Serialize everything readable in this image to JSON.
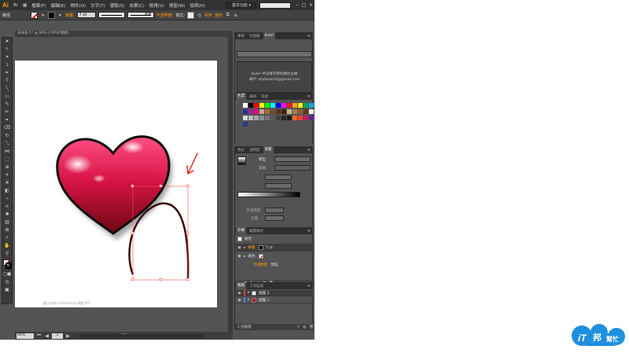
{
  "app": {
    "logo": "Ai"
  },
  "menu": [
    "檔案(F)",
    "編輯(E)",
    "物件(O)",
    "文字(T)",
    "選取(S)",
    "效果(C)",
    "檢視(V)",
    "視窗(W)",
    "說明(H)"
  ],
  "workspace": {
    "label": "基本功能 ▾"
  },
  "control_bar": {
    "selection_label": "路徑",
    "stroke_label": "筆畫:",
    "stroke_weight": "7 pt",
    "stroke_profile_label": "基本",
    "opacity_label": "不透明度:",
    "style_label": "樣式:",
    "align_label": "對齊",
    "transform_label": "變形"
  },
  "document": {
    "tab_label": "未命名-1* @ 90% (CMYK/預視)"
  },
  "canvas": {
    "watermark": "圖片來源 shutterstock 網路 PPT"
  },
  "status": {
    "zoom": "90%",
    "page": "1",
    "mode": "選取"
  },
  "panels": {
    "kuler": {
      "tabs": [
        "筆刷",
        "符號庫",
        "Kuler"
      ],
      "active_tab": "Kuler",
      "line1": "Kuler 中沒有可用的顏色主題",
      "line2": "帳戶: stylepan12@gmail.com"
    },
    "swatches": {
      "tabs": [
        "色票",
        "筆刷",
        "符號"
      ],
      "active_tab": "色票",
      "colors": [
        "#ffffff",
        "#000000",
        "#ff0000",
        "#ffff00",
        "#00ff00",
        "#00ffff",
        "#0000ff",
        "#ff00ff",
        "#e8191b",
        "#f6a11a",
        "#fff200",
        "#00a651",
        "#00aeef",
        "#2e3192",
        "#92278f",
        "#ec008c",
        "#c8a882",
        "#9e6b3d",
        "#7a4a2a",
        "#5a3420",
        "#3b2214",
        "#c7b299",
        "#a67c52",
        "#8c6239",
        "#603913",
        "#f5f5f5",
        "#d9d9d9",
        "#bfbfbf",
        "#a6a6a6",
        "#8c8c8c",
        "#737373",
        "#595959",
        "#404040",
        "#262626",
        "#1a1a1a",
        "#f26522",
        "#ef4136",
        "#c2185b",
        "#6a1b9a",
        "#283593"
      ]
    },
    "gradient": {
      "tabs": [
        "色彩",
        "透明度",
        "漸層"
      ],
      "active_tab": "漸層",
      "type_label": "類型:",
      "stroke_label": "筆畫:",
      "opacity_label": "不透明度:",
      "location_label": "位置:"
    },
    "appearance": {
      "tabs": [
        "外觀",
        "繪圖樣式"
      ],
      "active_tab": "外觀",
      "title": "路徑",
      "stroke_label": "筆畫:",
      "stroke_value": "7 pt",
      "fill_label": "填色:",
      "opacity_label": "不透明度:",
      "opacity_value": "預設"
    },
    "layers": {
      "tabs": [
        "圖層",
        "工作區域"
      ],
      "active_tab": "圖層",
      "items": [
        {
          "name": "圖層 2",
          "color": "#ff4040"
        },
        {
          "name": "圖層 1",
          "color": "#4f7fff"
        }
      ],
      "count_label": "2 個圖層"
    }
  },
  "colors": {
    "accent": "#ff9a00",
    "heart_top": "#ff5a8a",
    "heart_bottom": "#7a0c14",
    "annotation": "#e02020",
    "selection": "#ff4d4d"
  },
  "brand_logo": {
    "text_left": "iT",
    "text_mid": "邦",
    "text_right": "幫忙"
  }
}
